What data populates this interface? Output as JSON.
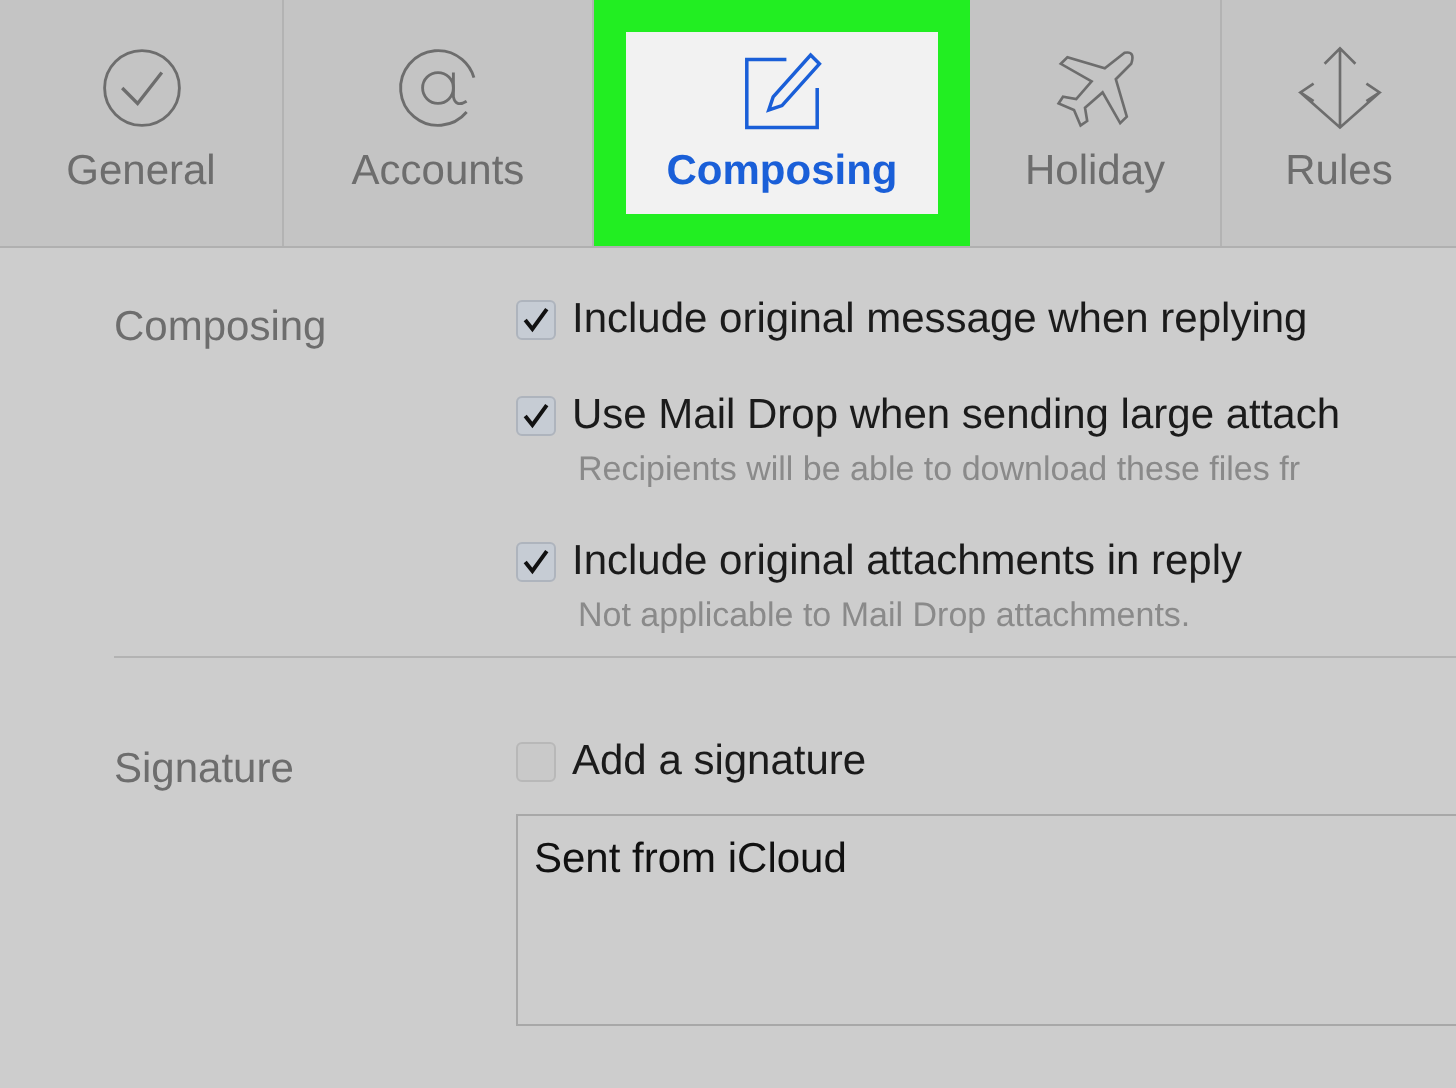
{
  "tabs": [
    {
      "label": "General",
      "selected": false
    },
    {
      "label": "Accounts",
      "selected": false
    },
    {
      "label": "Composing",
      "selected": true
    },
    {
      "label": "Holiday",
      "selected": false
    },
    {
      "label": "Rules",
      "selected": false
    }
  ],
  "sections": [
    {
      "title": "Composing",
      "options": [
        {
          "label": "Include original message when replying",
          "checked": true
        },
        {
          "label": "Use Mail Drop when sending large attach",
          "checked": true,
          "note": "Recipients will be able to download these files fr"
        },
        {
          "label": "Include original attachments in reply",
          "checked": true,
          "note": "Not applicable to Mail Drop attachments."
        }
      ]
    },
    {
      "title": "Signature",
      "options": [
        {
          "label": "Add a signature",
          "checked": false
        }
      ],
      "signature_text": "Sent from iCloud"
    }
  ]
}
